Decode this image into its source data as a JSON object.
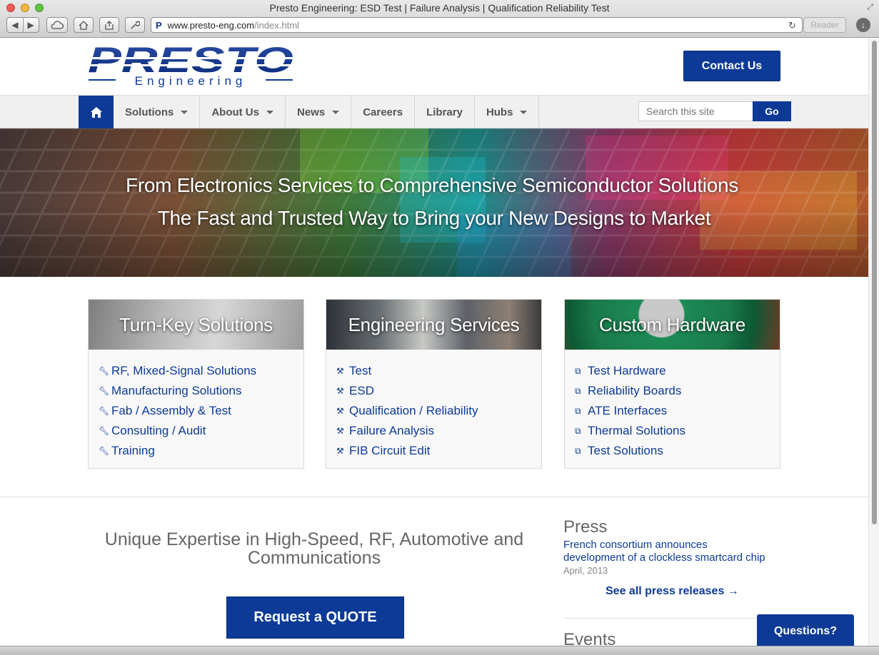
{
  "browser": {
    "window_title": "Presto Engineering: ESD Test | Failure Analysis | Qualification Reliability Test",
    "url_host": "www.presto-eng.com",
    "url_path": "/index.html",
    "reader_label": "Reader"
  },
  "header": {
    "logo_text": "PRESTO",
    "logo_sub": "Engineering",
    "contact_label": "Contact Us"
  },
  "nav": {
    "items": [
      {
        "label": "Solutions",
        "dropdown": true
      },
      {
        "label": "About Us",
        "dropdown": true
      },
      {
        "label": "News",
        "dropdown": true
      },
      {
        "label": "Careers",
        "dropdown": false
      },
      {
        "label": "Library",
        "dropdown": false
      },
      {
        "label": "Hubs",
        "dropdown": true
      }
    ],
    "search_placeholder": "Search this site",
    "search_button": "Go"
  },
  "hero": {
    "line1": "From Electronics Services to Comprehensive Semiconductor Solutions",
    "line2": "The Fast and Trusted Way to Bring your New Designs to Market"
  },
  "cards": [
    {
      "title": "Turn-Key Solutions",
      "icon": "wrench-icon",
      "items": [
        "RF, Mixed-Signal Solutions",
        "Manufacturing Solutions",
        "Fab / Assembly & Test",
        "Consulting / Audit",
        "Training"
      ]
    },
    {
      "title": "Engineering Services",
      "icon": "tools-icon",
      "items": [
        "Test",
        "ESD",
        "Qualification / Reliability",
        "Failure Analysis",
        "FIB Circuit Edit"
      ]
    },
    {
      "title": "Custom Hardware",
      "icon": "sitemap-icon",
      "items": [
        "Test Hardware",
        "Reliability Boards",
        "ATE Interfaces",
        "Thermal Solutions",
        "Test Solutions"
      ]
    }
  ],
  "tagline": "Unique Expertise in High-Speed, RF, Automotive and Communications",
  "quote_label": "Request a QUOTE",
  "press": {
    "title": "Press",
    "headline": "French consortium announces development of a clockless smartcard chip",
    "date": "April, 2013",
    "see_all": "See all press releases →"
  },
  "events": {
    "title": "Events"
  },
  "questions_label": "Questions?",
  "colors": {
    "brand_blue": "#0c3a96"
  }
}
